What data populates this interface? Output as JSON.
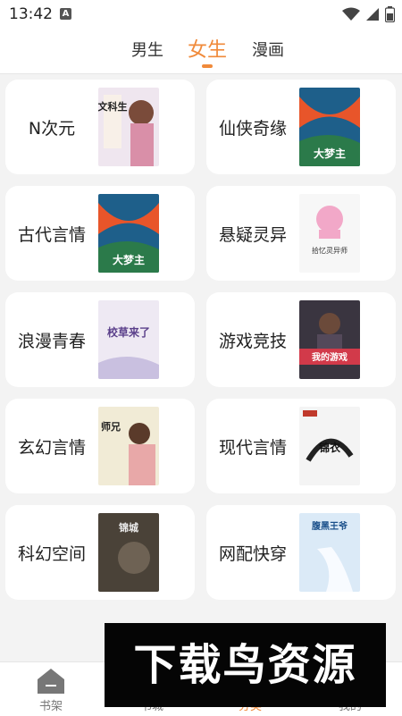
{
  "status_bar": {
    "time": "13:42",
    "notification_letter": "A"
  },
  "tabs": [
    {
      "label": "男生",
      "active": false
    },
    {
      "label": "女生",
      "active": true
    },
    {
      "label": "漫画",
      "active": false
    }
  ],
  "categories": [
    {
      "label": "N次元",
      "cover_text": "文科生"
    },
    {
      "label": "仙侠奇缘",
      "cover_text": "大梦主"
    },
    {
      "label": "古代言情",
      "cover_text": "大梦主"
    },
    {
      "label": "悬疑灵异",
      "cover_text": "拾忆灵异师"
    },
    {
      "label": "浪漫青春",
      "cover_text": "校草来了"
    },
    {
      "label": "游戏竞技",
      "cover_text": "我的游戏"
    },
    {
      "label": "玄幻言情",
      "cover_text": "师兄"
    },
    {
      "label": "现代言情",
      "cover_text": "锦衣"
    },
    {
      "label": "科幻空间",
      "cover_text": "锦城"
    },
    {
      "label": "网配快穿",
      "cover_text": "腹黑王爷"
    }
  ],
  "bottom_nav": [
    {
      "label": "书架",
      "icon": "bookshelf-icon",
      "active": false
    },
    {
      "label": "书城",
      "icon": "bookstore-icon",
      "active": false
    },
    {
      "label": "分类",
      "icon": "category-icon",
      "active": true
    },
    {
      "label": "我的",
      "icon": "profile-icon",
      "active": false
    }
  ],
  "banner": {
    "text": "下载鸟资源"
  },
  "colors": {
    "accent": "#f08a3a",
    "background": "#f3f3f3",
    "card": "#ffffff"
  }
}
